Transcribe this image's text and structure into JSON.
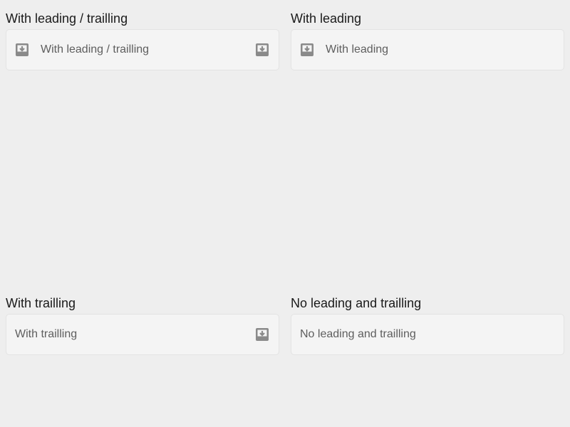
{
  "sections": [
    {
      "title": "With leading / trailling",
      "field_text": "With leading / trailling",
      "leading_icon": "download-box-icon",
      "trailing_icon": "download-box-icon"
    },
    {
      "title": "With leading",
      "field_text": "With leading",
      "leading_icon": "download-box-icon",
      "trailing_icon": null
    },
    {
      "title": "With trailling",
      "field_text": "With trailling",
      "leading_icon": null,
      "trailing_icon": "download-box-icon"
    },
    {
      "title": "No leading and trailling",
      "field_text": "No leading and trailling",
      "leading_icon": null,
      "trailing_icon": null
    }
  ],
  "colors": {
    "background": "#eeeeee",
    "field_background": "#f4f4f4",
    "field_border": "#e3e3e3",
    "icon": "#8a8a8a",
    "title_text": "#1a1a1a",
    "field_text": "#5e5e5e"
  }
}
